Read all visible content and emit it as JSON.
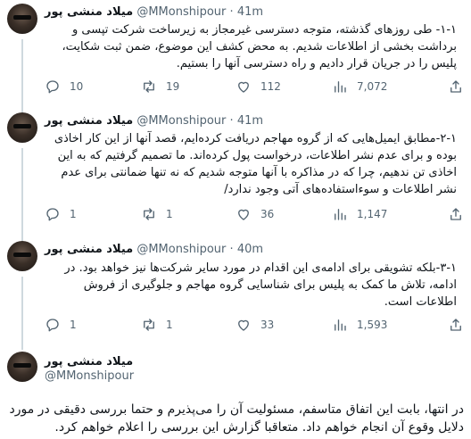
{
  "author": {
    "name": "میلاد منشی پور",
    "handle": "@MMonshipour"
  },
  "tweets": [
    {
      "time": "41m",
      "text": "۱-۱- طی روزهای گذشته، متوجه دسترسی غیرمجاز به زیرساخت شرکت تپسی و برداشت بخشی از اطلاعات شدیم. به محض کشف این موضوع، ضمن ثبت شکایت، پلیس را در جریان قرار دادیم و راه دسترسی آنها را بستیم.",
      "replies": "10",
      "retweets": "19",
      "likes": "112",
      "views": "7,072"
    },
    {
      "time": "41m",
      "text": "۲-۱-مطابق ایمیل‌هایی که از گروه مهاجم دریافت کرده‌ایم، قصد آنها از این کار اخاذی بوده و برای عدم نشر اطلاعات، درخواست پول کرده‌اند. ما تصمیم گرفتیم که به این اخاذی تن ندهیم، چرا که در مذاکره با آنها متوجه شدیم که نه تنها ضمانتی برای عدم نشر اطلاعات و سوءاستفاده‌های آتی وجود ندارد/",
      "replies": "1",
      "retweets": "1",
      "likes": "36",
      "views": "1,147"
    },
    {
      "time": "40m",
      "text": "۳-۱-بلکه تشویقی برای ادامه‌ی این اقدام در مورد سایر شرکت‌ها نیز خواهد بود. در ادامه، تلاش ما کمک به پلیس برای شناسایی گروه مهاجم و جلوگیری از فروش اطلاعات است.",
      "replies": "1",
      "retweets": "1",
      "likes": "33",
      "views": "1,593"
    }
  ],
  "final_tweet": {
    "text": "در انتها، بابت این اتفاق متاسفم، مسئولیت آن را می‌پذیرم و حتما بررسی دقیقی در مورد دلایل وقوع آن انجام خواهم داد. متعاقبا گزارش این بررسی را اعلام خواهم کرد."
  },
  "icons": [
    "reply-icon",
    "retweet-icon",
    "like-icon",
    "views-icon",
    "share-icon"
  ],
  "colors": {
    "muted": "#536471",
    "text": "#0f1419",
    "thread_line": "#cfd9de"
  }
}
